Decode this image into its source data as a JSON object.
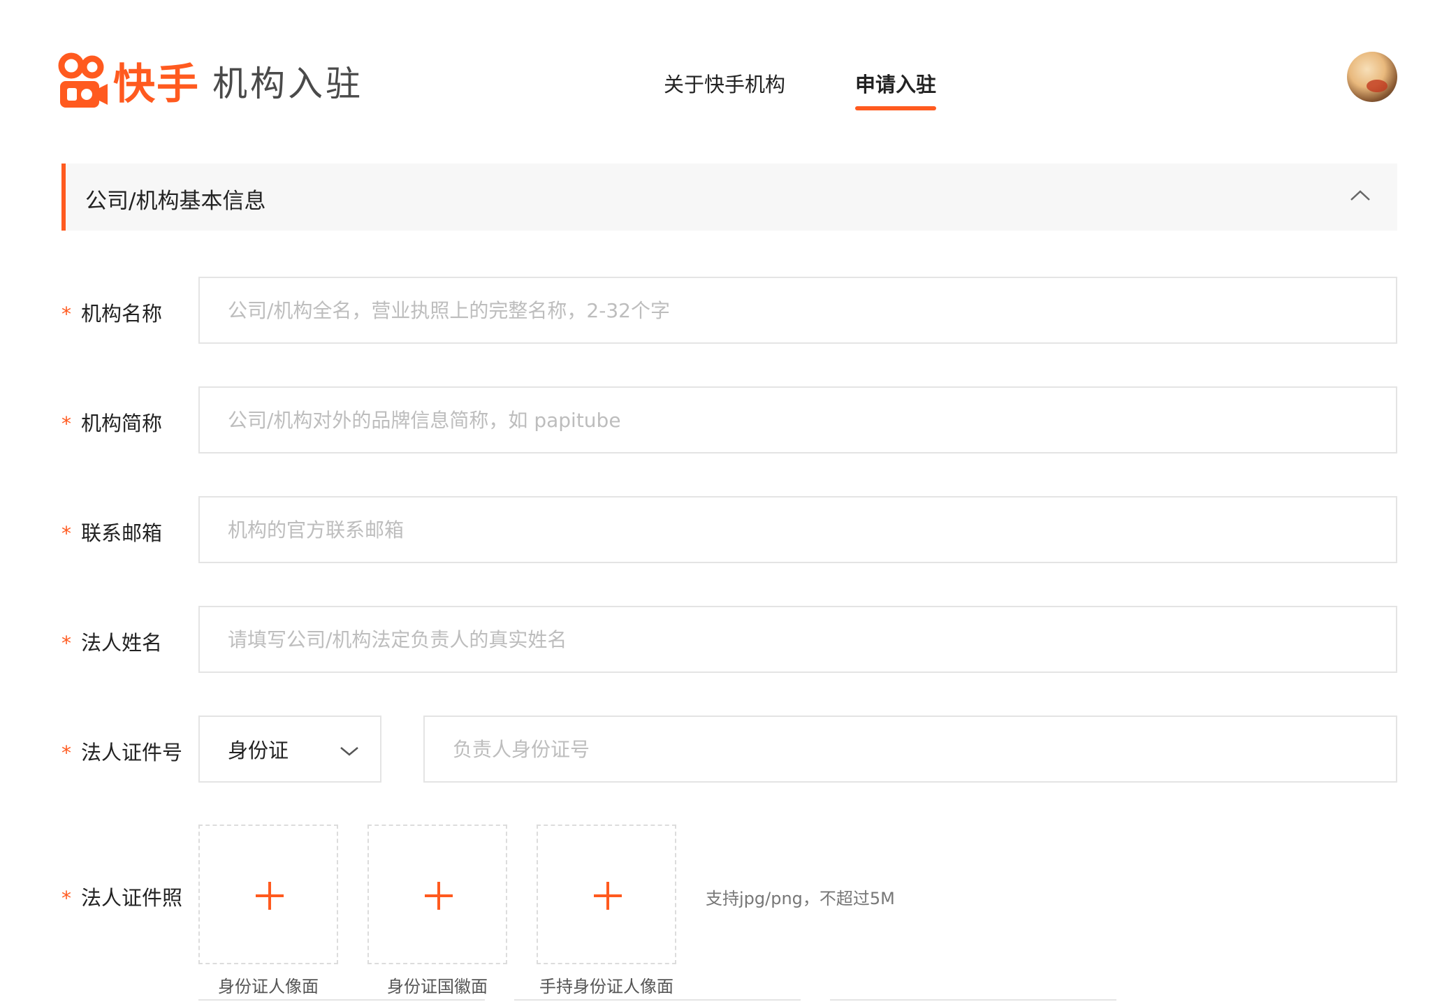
{
  "header": {
    "brand": "快手",
    "brand_sub": "机构入驻",
    "nav": [
      {
        "label": "关于快手机构",
        "active": false
      },
      {
        "label": "申请入驻",
        "active": true
      }
    ]
  },
  "section": {
    "title": "公司/机构基本信息"
  },
  "form": {
    "required_mark": "*",
    "org_name": {
      "label": "机构名称",
      "placeholder": "公司/机构全名，营业执照上的完整名称，2-32个字"
    },
    "org_short": {
      "label": "机构简称",
      "placeholder": "公司/机构对外的品牌信息简称，如 papitube"
    },
    "email": {
      "label": "联系邮箱",
      "placeholder": "机构的官方联系邮箱"
    },
    "legal_name": {
      "label": "法人姓名",
      "placeholder": "请填写公司/机构法定负责人的真实姓名"
    },
    "legal_id": {
      "label": "法人证件号",
      "id_type": "身份证",
      "placeholder": "负责人身份证号"
    },
    "legal_photo": {
      "label": "法人证件照",
      "uploads": [
        "身份证人像面",
        "身份证国徽面",
        "手持身份证人像面"
      ],
      "hint": "支持jpg/png，不超过5M"
    }
  },
  "colors": {
    "accent": "#ff5a1f"
  }
}
